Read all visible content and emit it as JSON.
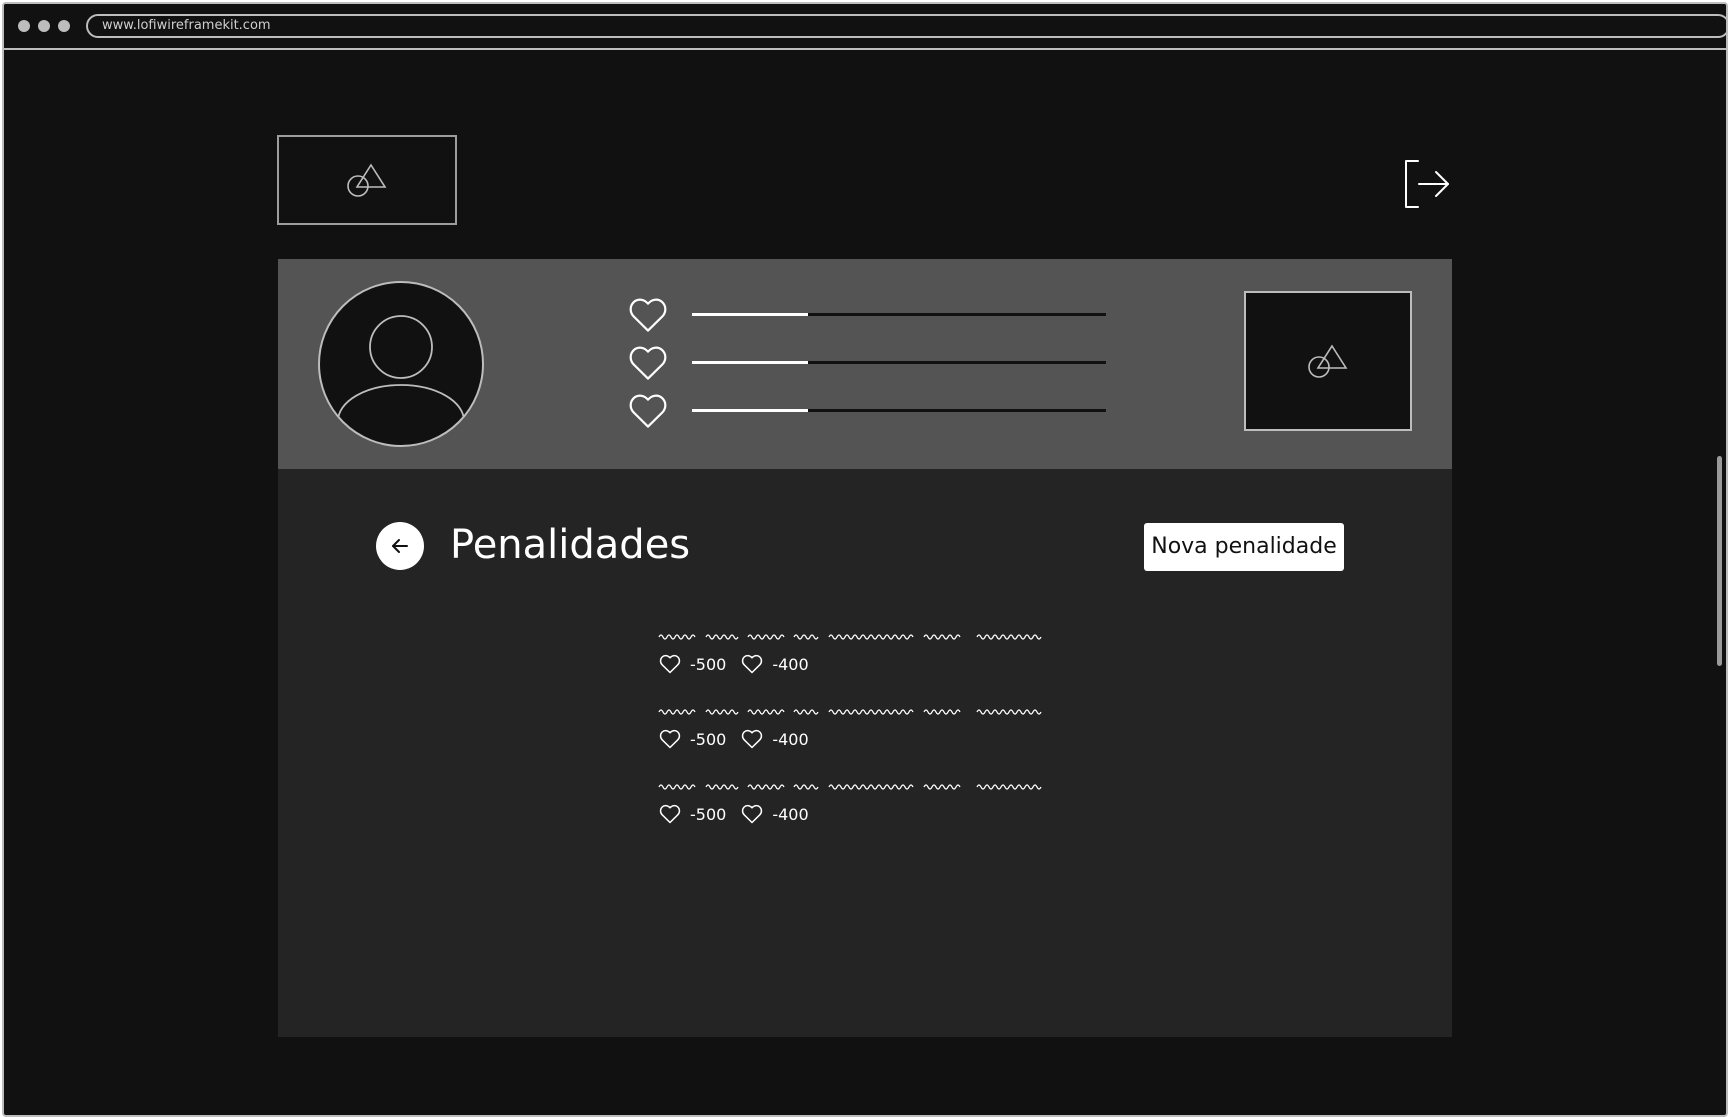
{
  "browser": {
    "url": "www.lofiwireframekit.com"
  },
  "header": {
    "logo_icon": "image-placeholder-icon",
    "exit_icon": "logout-icon"
  },
  "profile": {
    "avatar_icon": "user-avatar-icon",
    "stats": [
      {
        "icon": "heart-icon",
        "progress": 0.28
      },
      {
        "icon": "heart-icon",
        "progress": 0.28
      },
      {
        "icon": "heart-icon",
        "progress": 0.28
      }
    ],
    "image_icon": "image-placeholder-icon"
  },
  "main": {
    "title": "Penalidades",
    "back_icon": "arrow-left-icon",
    "new_button_label": "Nova penalidade",
    "penalties": [
      {
        "score_a": "-500",
        "score_b": "-400"
      },
      {
        "score_a": "-500",
        "score_b": "-400"
      },
      {
        "score_a": "-500",
        "score_b": "-400"
      }
    ]
  },
  "colors": {
    "background": "#111111",
    "profile_panel": "#545454",
    "content_panel": "#242424",
    "accent": "#ffffff"
  }
}
